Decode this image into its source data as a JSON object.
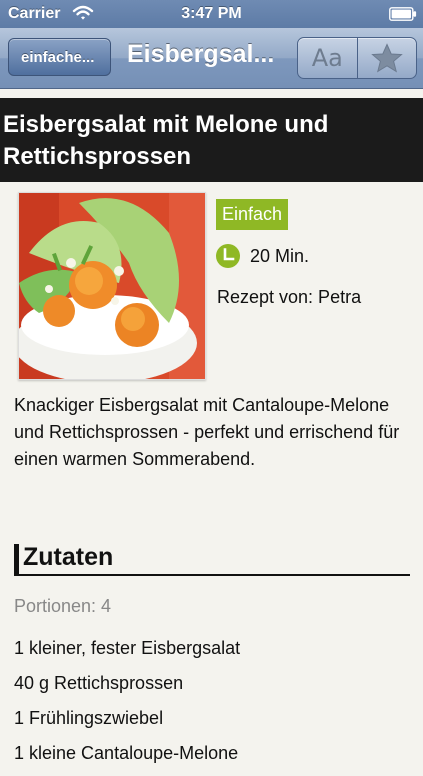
{
  "status_bar": {
    "carrier": "Carrier",
    "time": "3:47 PM"
  },
  "nav": {
    "back_label": "einfache...",
    "title": "Eisbergsal...",
    "font_button_label": "Aa",
    "font_button_icon": "text-size-icon",
    "favorite_icon": "star-icon"
  },
  "recipe": {
    "title": " Eisbergsalat mit Melone und Rettichsprossen",
    "difficulty": "Einfach",
    "duration": "20 Min.",
    "author": "Rezept von: Petra",
    "description": "Knackiger Eisbergsalat mit Cantaloupe-Melone und Rettichsprossen - perfekt und errischend für einen warmen Sommerabend."
  },
  "ingredients": {
    "heading": "Zutaten",
    "servings": "Portionen: 4",
    "items": [
      "1 kleiner, fester Eisbergsalat",
      "40 g Rettichsprossen",
      "1 Frühlingszwiebel",
      "1 kleine Cantaloupe-Melone"
    ]
  },
  "colors": {
    "nav_bar": "#7e98bd",
    "header_background": "#1b1b1b",
    "difficulty_badge": "#8fb825",
    "page_background": "#f4f3ee"
  }
}
